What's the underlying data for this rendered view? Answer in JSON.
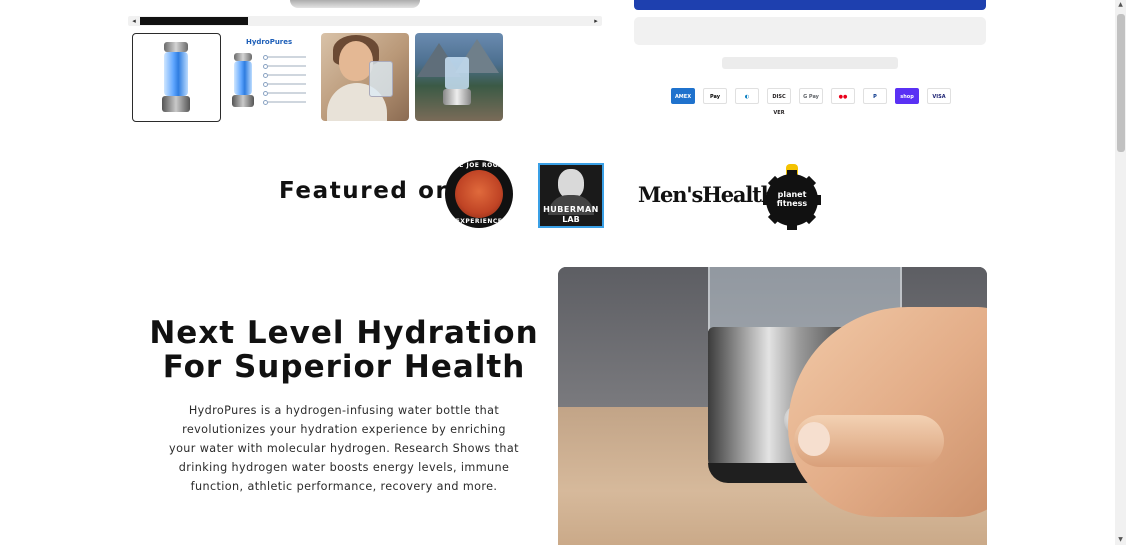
{
  "gallery": {
    "scroll_left": "◂",
    "scroll_right": "▸",
    "thumbnails": [
      {
        "label": ""
      },
      {
        "label": "HydroPures"
      },
      {
        "label": ""
      },
      {
        "label": ""
      }
    ]
  },
  "payments": [
    {
      "name": "American Express",
      "text": "AMEX",
      "bg": "#1f72cd",
      "fg": "#ffffff",
      "icon": "amex-icon"
    },
    {
      "name": "Apple Pay",
      "text": "Pay",
      "bg": "#ffffff",
      "fg": "#000000",
      "icon": "apple-pay-icon"
    },
    {
      "name": "Diners Club",
      "text": "◐",
      "bg": "#ffffff",
      "fg": "#0079be",
      "icon": "diners-club-icon"
    },
    {
      "name": "Discover",
      "text": "DISC VER",
      "bg": "#ffffff",
      "fg": "#231f20",
      "icon": "discover-icon"
    },
    {
      "name": "Google Pay",
      "text": "G Pay",
      "bg": "#ffffff",
      "fg": "#5f6368",
      "icon": "google-pay-icon"
    },
    {
      "name": "Mastercard",
      "text": "●●",
      "bg": "#ffffff",
      "fg": "#eb001b",
      "icon": "mastercard-icon"
    },
    {
      "name": "PayPal",
      "text": "P",
      "bg": "#ffffff",
      "fg": "#003087",
      "icon": "paypal-icon"
    },
    {
      "name": "Shop Pay",
      "text": "shop",
      "bg": "#5a31f4",
      "fg": "#ffffff",
      "icon": "shop-pay-icon"
    },
    {
      "name": "Visa",
      "text": "VISA",
      "bg": "#ffffff",
      "fg": "#1a1f71",
      "icon": "visa-icon"
    }
  ],
  "featured": {
    "label": "Featured on",
    "logos": {
      "rogan_top": "THE JOE ROGAN",
      "rogan_bottom": "EXPERIENCE",
      "huberman_1": "HUBERMAN",
      "huberman_2": "LAB",
      "menshealth": "Men'sHealth",
      "planet": "planet fitness"
    }
  },
  "hydration": {
    "title_line1": "Next Level Hydration",
    "title_line2": "For Superior Health",
    "body": "HydroPures is a hydrogen-infusing water bottle that revolutionizes your hydration experience by enriching your water with molecular hydrogen. Research Shows that drinking hydrogen water boosts energy levels, immune function, athletic performance, recovery and more."
  },
  "colors": {
    "primary_button": "#1e40af",
    "text": "#121212"
  }
}
